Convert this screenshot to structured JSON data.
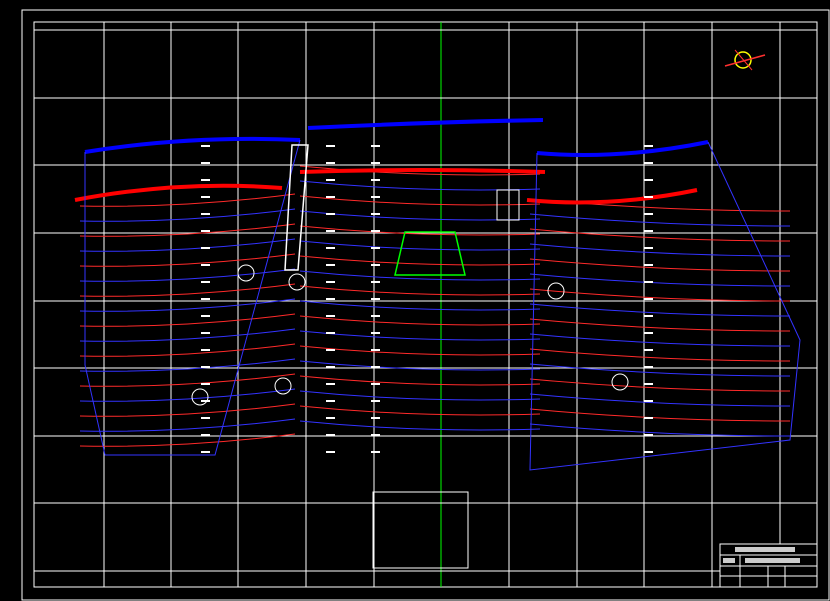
{
  "drawing": {
    "background": "#000000",
    "frame_color": "#ffffff",
    "grid_color": "#ffffff",
    "axis_color": "#00ff00",
    "colors": {
      "roadway_blue": "#0000ff",
      "roadway_red": "#ff0000",
      "contour_red": "#ff2a2a",
      "contour_blue": "#3333ff",
      "marker_white": "#ffffff",
      "outline_green": "#00ff00"
    },
    "panels": [
      "left",
      "middle",
      "right"
    ],
    "compass_icon": "north-arrow-icon"
  }
}
